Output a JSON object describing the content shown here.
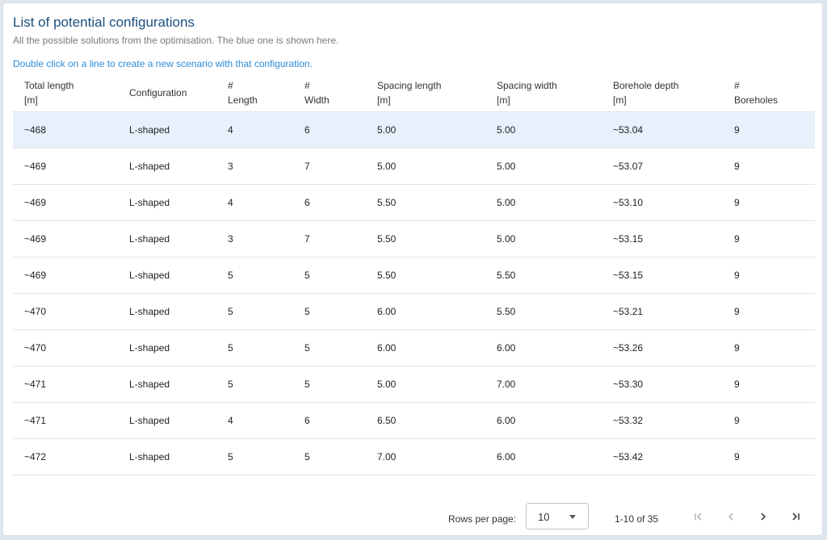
{
  "header": {
    "title": "List of potential configurations",
    "subtitle": "All the possible solutions from the optimisation. The blue one is shown here.",
    "hint": "Double click on a line to create a new scenario with that configuration."
  },
  "table": {
    "columns": [
      {
        "line1": "Total length",
        "line2": "[m]"
      },
      {
        "line1": "Configuration",
        "line2": ""
      },
      {
        "line1": "#",
        "line2": "Length"
      },
      {
        "line1": "#",
        "line2": "Width"
      },
      {
        "line1": "Spacing length",
        "line2": "[m]"
      },
      {
        "line1": "Spacing width",
        "line2": "[m]"
      },
      {
        "line1": "Borehole depth",
        "line2": "[m]"
      },
      {
        "line1": "#",
        "line2": "Boreholes"
      }
    ],
    "rows": [
      [
        "~468",
        "L-shaped",
        "4",
        "6",
        "5.00",
        "5.00",
        "~53.04",
        "9"
      ],
      [
        "~469",
        "L-shaped",
        "3",
        "7",
        "5.00",
        "5.00",
        "~53.07",
        "9"
      ],
      [
        "~469",
        "L-shaped",
        "4",
        "6",
        "5.50",
        "5.00",
        "~53.10",
        "9"
      ],
      [
        "~469",
        "L-shaped",
        "3",
        "7",
        "5.50",
        "5.00",
        "~53.15",
        "9"
      ],
      [
        "~469",
        "L-shaped",
        "5",
        "5",
        "5.50",
        "5.50",
        "~53.15",
        "9"
      ],
      [
        "~470",
        "L-shaped",
        "5",
        "5",
        "6.00",
        "5.50",
        "~53.21",
        "9"
      ],
      [
        "~470",
        "L-shaped",
        "5",
        "5",
        "6.00",
        "6.00",
        "~53.26",
        "9"
      ],
      [
        "~471",
        "L-shaped",
        "5",
        "5",
        "5.00",
        "7.00",
        "~53.30",
        "9"
      ],
      [
        "~471",
        "L-shaped",
        "4",
        "6",
        "6.50",
        "6.00",
        "~53.32",
        "9"
      ],
      [
        "~472",
        "L-shaped",
        "5",
        "5",
        "7.00",
        "6.00",
        "~53.42",
        "9"
      ]
    ],
    "selected_row": 0
  },
  "pagination": {
    "rows_per_page_label": "Rows per page:",
    "rows_per_page_value": "10",
    "range_text": "1-10 of 35",
    "icons": [
      "first-page-icon",
      "previous-page-icon",
      "next-page-icon",
      "last-page-icon"
    ]
  },
  "colors": {
    "title": "#1d4f7c",
    "hint": "#2d8bd6",
    "selected_row_bg": "#e6f1fc",
    "disabled_icon": "#b8b8b8",
    "enabled_icon": "#444444"
  }
}
